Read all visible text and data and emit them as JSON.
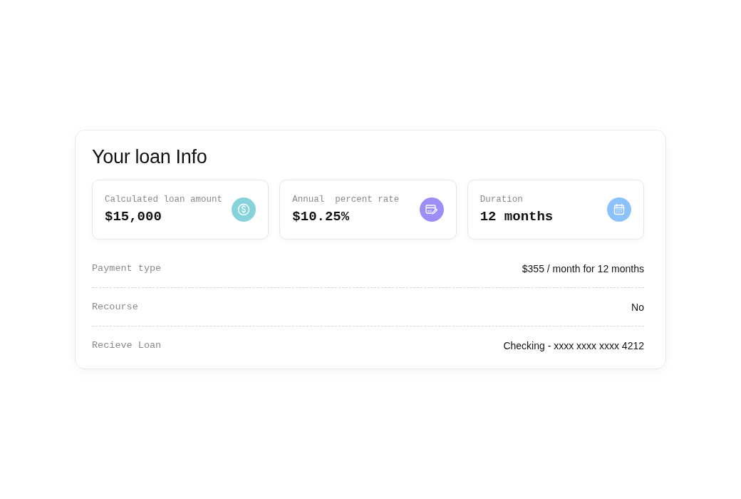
{
  "title": "Your loan Info",
  "stats": [
    {
      "label": "Calculated loan amount",
      "value": "$15,000",
      "kind": "dollar",
      "color": "#87d3dc"
    },
    {
      "label": "Annual  percent rate",
      "value": "$10.25%",
      "kind": "card",
      "color": "#9b8ff7"
    },
    {
      "label": "Duration",
      "value": "12 months",
      "kind": "calendar",
      "color": "#8cc2fb"
    }
  ],
  "details": [
    {
      "label": "Payment type",
      "value": "$355 / month for 12 months"
    },
    {
      "label": "Recourse",
      "value": "No"
    },
    {
      "label": "Recieve Loan",
      "value": "Checking - xxxx xxxx xxxx 4212"
    }
  ]
}
